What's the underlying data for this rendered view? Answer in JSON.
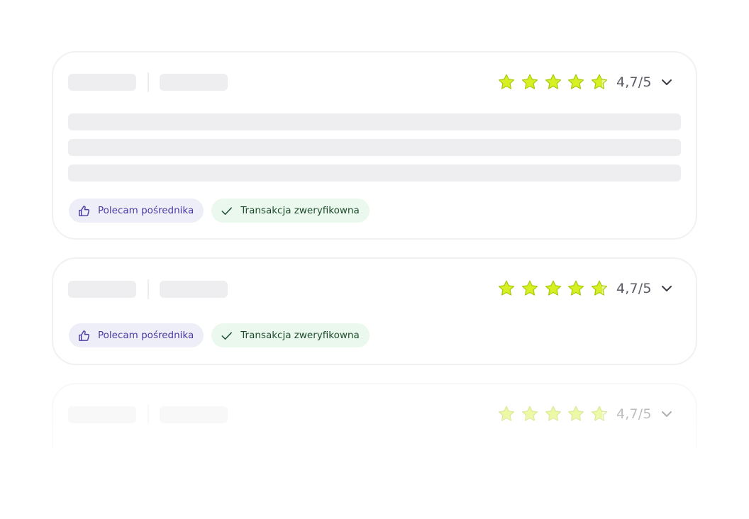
{
  "reviews": [
    {
      "rating_text": "4,7/5",
      "rating_value": 4.7,
      "rating_max": 5,
      "tags": {
        "recommend": "Polecam pośrednika",
        "verified": "Transakcja zweryfikowna"
      }
    },
    {
      "rating_text": "4,7/5",
      "rating_value": 4.7,
      "rating_max": 5,
      "tags": {
        "recommend": "Polecam pośrednika",
        "verified": "Transakcja zweryfikowna"
      }
    },
    {
      "rating_text": "4,7/5",
      "rating_value": 4.7,
      "rating_max": 5
    }
  ],
  "colors": {
    "star_fill": "#d6f023",
    "star_stroke": "#a8c80a",
    "recommend_bg": "#eeeef8",
    "recommend_text": "#4a3ba6",
    "verified_bg": "#eaf8ee",
    "verified_text": "#1e4a2c",
    "skeleton": "#eeeef0"
  },
  "icons": {
    "star": "star-icon",
    "chevron": "chevron-down-icon",
    "thumb": "thumbs-up-icon",
    "check": "check-icon"
  }
}
